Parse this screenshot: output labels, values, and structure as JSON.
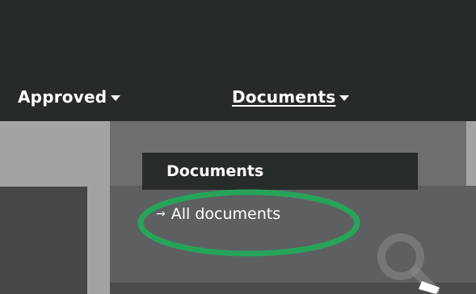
{
  "nav": {
    "items": [
      {
        "label": "Approved"
      },
      {
        "label": "Documents"
      }
    ]
  },
  "dropdown": {
    "heading": "Documents",
    "items": [
      {
        "arrow": "→",
        "label": "All documents"
      }
    ]
  },
  "annotation": {
    "highlight_color": "#27a35a"
  },
  "icons": {
    "caret": "caret-down-icon",
    "arrow": "arrow-right-icon",
    "search": "search-icon"
  }
}
